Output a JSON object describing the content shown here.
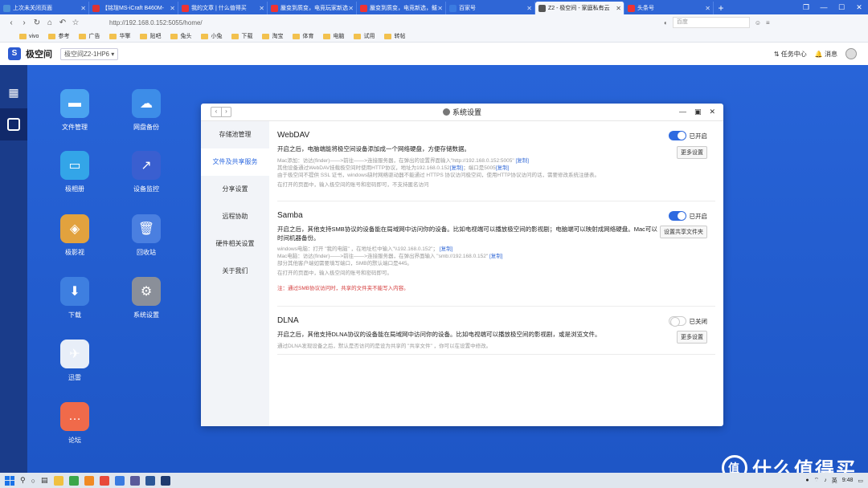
{
  "browser": {
    "tabs": [
      {
        "label": "上次未关闭页面",
        "color": "#4a90d9"
      },
      {
        "label": "【铭瑄MS-iCraft B460M-",
        "color": "#d33"
      },
      {
        "label": "我的文章 | 什么值得买",
        "color": "#e33"
      },
      {
        "label": "蜃变到质变，电竞玩家新选",
        "color": "#e33"
      },
      {
        "label": "蜃变到质变，电竞新选，鲅",
        "color": "#e33"
      },
      {
        "label": "百家号",
        "color": "#3b7be0"
      },
      {
        "label": "Z2 - 极空间 - 家庭私有云",
        "color": "#555",
        "active": true
      },
      {
        "label": "头条号",
        "color": "#e33"
      }
    ],
    "url": "http://192.168.0.152:5055/home/",
    "search_placeholder": "百度",
    "bookmarks": [
      "vivo",
      "参考",
      "广告",
      "华擎",
      "贴吧",
      "兔头",
      "小兔",
      "下载",
      "淘宝",
      "体育",
      "电脑",
      "试用",
      "转帖"
    ]
  },
  "app": {
    "name": "极空间",
    "device": "极空间Z2-1HP6 ▾",
    "task_center": "任务中心",
    "messages": "消息"
  },
  "desktop_icons": [
    {
      "label": "文件管理",
      "color": "#4aa3f0",
      "glyph": "▬"
    },
    {
      "label": "网盘备份",
      "color": "#3d8de8",
      "glyph": "☁"
    },
    {
      "label": "极相册",
      "color": "#33a5e8",
      "glyph": "▭"
    },
    {
      "label": "设备监控",
      "color": "#3a5fd0",
      "glyph": "↗"
    },
    {
      "label": "极影视",
      "color": "#e2a23e",
      "glyph": "◈"
    },
    {
      "label": "回收站",
      "color": "#4a7fe0",
      "glyph": "🗑"
    },
    {
      "label": "下载",
      "color": "#3e7fe0",
      "glyph": "⬇"
    },
    {
      "label": "系统设置",
      "color": "#8a8f99",
      "glyph": "⚙"
    },
    {
      "label": "迅雷",
      "color": "#e8eef8",
      "glyph": "✈"
    },
    {
      "label": "论坛",
      "color": "#f06a4a",
      "glyph": "…"
    }
  ],
  "window": {
    "title": "系统设置",
    "sidebar": [
      "存储池管理",
      "文件及共享服务",
      "分享设置",
      "远程协助",
      "硬件相关设置",
      "关于我们"
    ],
    "selected": 1,
    "webdav": {
      "title": "WebDAV",
      "status": "已开启",
      "desc": "开启之后，电脑端能将极空间设备添加成一个网络硬盘，方便存储数据。",
      "button": "更多设置",
      "notes": [
        "Mac添加：访达(finder)——>前往——>连接服务器，在弹出的设置界面输入\"http://192.168.0.152:5005\"",
        "其他设备通过WebDAV挂载极空间时使用HTTP协议，地址为192.168.0.152",
        "由于极空间不提供 SSL 证书，windows缺时网络驱动器不能通过 HTTPS 协议访问极空间，使用HTTP协议访问的话，需要修改系统注册表。",
        "在打开的页面中，输入极空间的账号和密码即可，不支持匿名访问"
      ],
      "copy": "[复制]",
      "port_note": "；端口是5005"
    },
    "samba": {
      "title": "Samba",
      "status": "已开启",
      "desc": "开启之后，其他支持SMB协议的设备能在局域网中访问你的设备。比如电视端可以播放极空间的影视剧；电脑端可以映射成网络硬盘。Mac可以时间机器备份。",
      "button": "设置共享文件夹",
      "notes": [
        "windows电脑：打开 \"我的电脑\" ，在地址栏中输入\"\\\\192.168.0.152\"；",
        "Mac电脑：访达(finder)——>前往——>连接服务器，在弹出界面输入 \"smb://192.168.0.152\"",
        "部分其他客户端如需要填写端口，SMB的默认端口是445。",
        "在打开的页面中，输入极空间的账号和密码即可。"
      ],
      "copy": "[复制]",
      "warning": "注：通过SMB协议访问时，共享的文件夹不能写入内容。"
    },
    "dlna": {
      "title": "DLNA",
      "status": "已关闭",
      "desc": "开启之后，其他支持DLNA协议的设备能在局域网中访问你的设备。比如电视端可以播放极空间的影视剧，或是浏览文件。",
      "button": "更多设置",
      "note": "通过DLNA发现设备之后，默认是否访问的是设为共享的 \"共享文件\" ，你可以在设置中修改。"
    }
  },
  "taskbar": {
    "time": "9:48",
    "lang": "英"
  },
  "watermark": {
    "glyph": "值",
    "text": "什么值得买"
  }
}
